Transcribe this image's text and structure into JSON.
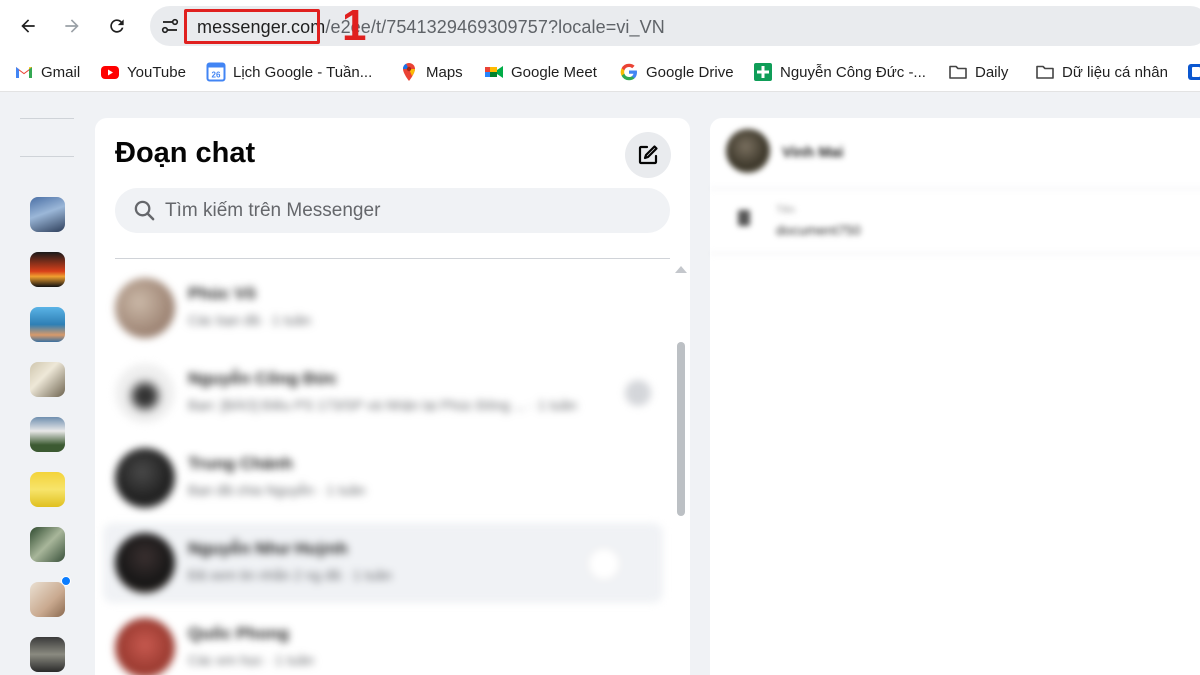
{
  "browser": {
    "url_host": "messenger.com",
    "url_path": "/e2ee/t/7541329469309757?locale=vi_VN",
    "annotation_number": "1",
    "annotation_color": "#e0201f",
    "nav_icons": [
      "back-arrow-icon",
      "forward-arrow-icon",
      "reload-icon",
      "site-info-icon"
    ]
  },
  "bookmarks": [
    {
      "label": "Gmail",
      "icon": "gmail-icon"
    },
    {
      "label": "YouTube",
      "icon": "youtube-icon"
    },
    {
      "label": "Lịch Google - Tuần...",
      "icon": "google-calendar-icon"
    },
    {
      "label": "Maps",
      "icon": "google-maps-icon"
    },
    {
      "label": "Google Meet",
      "icon": "google-meet-icon"
    },
    {
      "label": "Google Drive",
      "icon": "google-icon"
    },
    {
      "label": "Nguyễn Công Đức -...",
      "icon": "google-sheets-icon"
    },
    {
      "label": "Daily",
      "icon": "folder-icon"
    },
    {
      "label": "Dữ liệu cá nhân",
      "icon": "folder-icon"
    }
  ],
  "messenger": {
    "title": "Đoạn chat",
    "search_placeholder": "Tìm kiếm trên Messenger",
    "accent_color": "#0a7cff",
    "conversations": [
      {
        "name": "Phúc Võ",
        "preview": "Các bạn đã · 1 tuần"
      },
      {
        "name": "Nguyễn Công Đức",
        "preview": "Bạn: [BÁO] Điều PS 173/SP và Nhận lại Phúc Đông ... · 1 tuần"
      },
      {
        "name": "Trung Chánh",
        "preview": "Bạn đã chia Nguyễn · 1 tuần"
      },
      {
        "name": "Nguyễn Như Huỳnh",
        "preview": "Đã xem tin nhắn 2 ng đã · 1 tuần"
      },
      {
        "name": "Quốc Phong",
        "preview": "Các em học · 1 tuần"
      }
    ],
    "right_panel": {
      "name": "Vinh Mai",
      "label": "Tên",
      "value": "document750"
    }
  }
}
